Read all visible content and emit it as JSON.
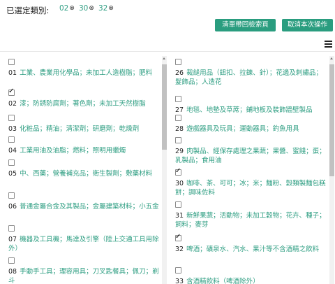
{
  "selected": {
    "label": "已選定類別:",
    "tags": [
      {
        "num": "02",
        "x": "⊗"
      },
      {
        "num": "30",
        "x": "⊗"
      },
      {
        "num": "32",
        "x": "⊗"
      }
    ]
  },
  "buttons": {
    "back": "清單帶回檢索頁",
    "cancel": "取消本次操作"
  },
  "left_items": [
    {
      "code": "01",
      "desc": "工業、農業用化學品；未加工人造樹脂；肥料",
      "checked": false
    },
    {
      "code": "02",
      "desc": "漆；防銹防腐劑；著色劑；未加工天然樹脂",
      "checked": true
    },
    {
      "code": "03",
      "desc": "化粧品；精油；清潔劑；研磨劑；乾燥劑",
      "checked": false
    },
    {
      "code": "04",
      "desc": "工業用油及油脂；燃料；照明用蠟燭",
      "checked": false
    },
    {
      "code": "05",
      "desc": "中、西藥；營養補充品；衛生製劑；敷藥材料",
      "checked": false
    },
    {
      "code": "06",
      "desc": "普通金屬合金及其製品；金屬建築材料；小五金",
      "checked": false
    },
    {
      "code": "07",
      "desc": "機器及工具機；馬達及引擎（陸上交通工具用除外）",
      "checked": false
    },
    {
      "code": "08",
      "desc": "手動手工具；理容用具；刀叉匙餐具；佩刀；剃斗",
      "checked": false
    }
  ],
  "right_items": [
    {
      "code": "26",
      "desc": "裁縫用品（鈕扣、拉鍊、針）；花邊及刺繡品；髮飾品；人造花",
      "checked": false
    },
    {
      "code": "27",
      "desc": "地毯、地墊及草蓆；鋪地板及裝飾牆壁製品",
      "checked": false
    },
    {
      "code": "28",
      "desc": "遊戲器具及玩具；運動器具；釣魚用具",
      "checked": false
    },
    {
      "code": "29",
      "desc": "肉製品、經保存處理之果蔬；果醬、蜜餞；蛋；乳製品；食用油",
      "checked": false
    },
    {
      "code": "30",
      "desc": "咖啡、茶、可可；冰；米；麵粉、穀類製麵包糕餅；調味佐料",
      "checked": true
    },
    {
      "code": "31",
      "desc": "新鮮果蔬；活動物；未加工穀物；花卉、種子；飼料；麥芽",
      "checked": false
    },
    {
      "code": "32",
      "desc": "啤酒；礦泉水、汽水、果汁等不含酒精之飲料",
      "checked": true
    },
    {
      "code": "33",
      "desc": "含酒精飲料（啤酒除外）",
      "checked": false
    }
  ]
}
